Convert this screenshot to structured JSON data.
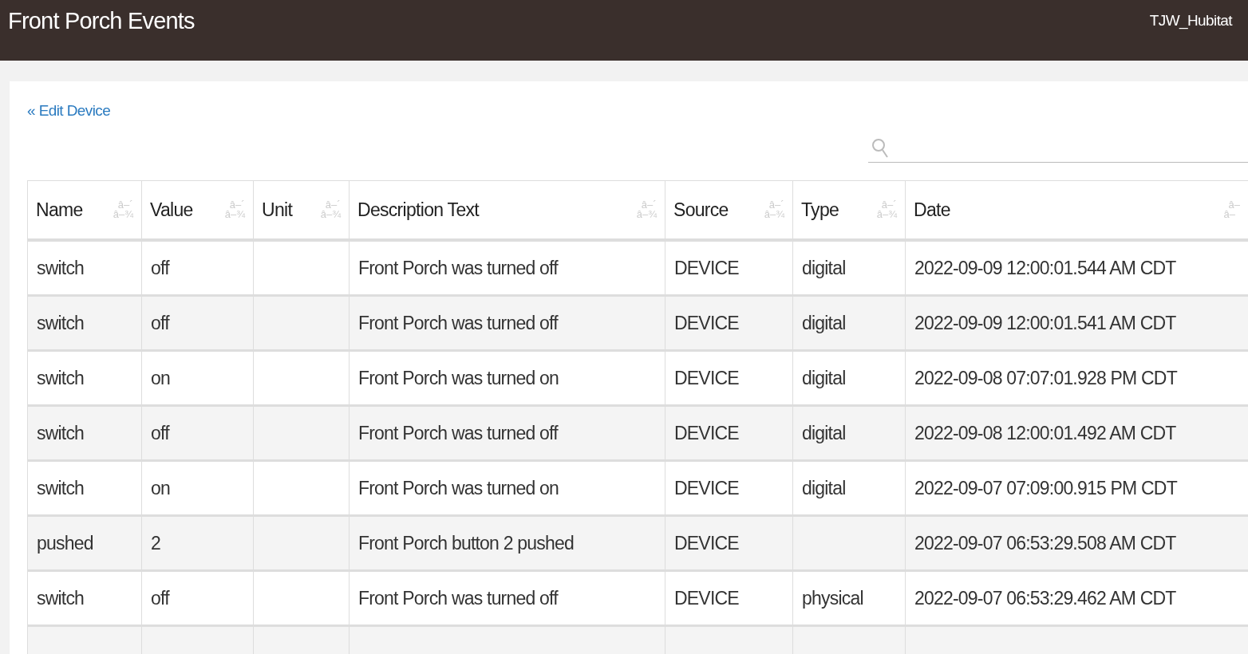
{
  "header": {
    "title": "Front Porch Events",
    "user": "TJW_Hubitat"
  },
  "back_link": "« Edit Device",
  "table": {
    "columns": [
      {
        "label": "Name",
        "sort_top": "â–´",
        "sort_bottom": "â–¾"
      },
      {
        "label": "Value",
        "sort_top": "â–´",
        "sort_bottom": "â–¾"
      },
      {
        "label": "Unit",
        "sort_top": "â–´",
        "sort_bottom": "â–¾"
      },
      {
        "label": "Description Text",
        "sort_top": "â–´",
        "sort_bottom": "â–¾"
      },
      {
        "label": "Source",
        "sort_top": "â–´",
        "sort_bottom": "â–¾"
      },
      {
        "label": "Type",
        "sort_top": "â–´",
        "sort_bottom": "â–¾"
      },
      {
        "label": "Date",
        "sort_top": "â–",
        "sort_bottom": "â–"
      }
    ],
    "rows": [
      [
        "switch",
        "off",
        "",
        "Front Porch was turned off",
        "DEVICE",
        "digital",
        "2022-09-09 12:00:01.544 AM CDT"
      ],
      [
        "switch",
        "off",
        "",
        "Front Porch was turned off",
        "DEVICE",
        "digital",
        "2022-09-09 12:00:01.541 AM CDT"
      ],
      [
        "switch",
        "on",
        "",
        "Front Porch was turned on",
        "DEVICE",
        "digital",
        "2022-09-08 07:07:01.928 PM CDT"
      ],
      [
        "switch",
        "off",
        "",
        "Front Porch was turned off",
        "DEVICE",
        "digital",
        "2022-09-08 12:00:01.492 AM CDT"
      ],
      [
        "switch",
        "on",
        "",
        "Front Porch was turned on",
        "DEVICE",
        "digital",
        "2022-09-07 07:09:00.915 PM CDT"
      ],
      [
        "pushed",
        "2",
        "",
        "Front Porch button 2 pushed",
        "DEVICE",
        "",
        "2022-09-07 06:53:29.508 AM CDT"
      ],
      [
        "switch",
        "off",
        "",
        "Front Porch was turned off",
        "DEVICE",
        "physical",
        "2022-09-07 06:53:29.462 AM CDT"
      ]
    ]
  }
}
